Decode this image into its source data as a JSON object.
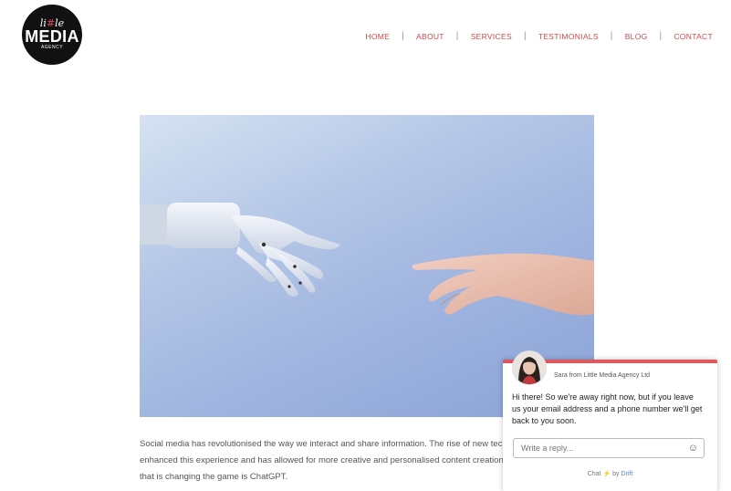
{
  "logo": {
    "line1_a": "li",
    "line1_hash": "#",
    "line1_b": "le",
    "line2": "MEDIA",
    "line3": "AGENCY"
  },
  "nav": {
    "items": [
      "HOME",
      "ABOUT",
      "SERVICES",
      "TESTIMONIALS",
      "BLOG",
      "CONTACT"
    ],
    "separator": "|"
  },
  "article": {
    "line1": "Social media has revolutionised the way we interact and share information. The rise of new tec",
    "line2": "enhanced this experience and has allowed for more creative and personalised content creation",
    "line3": "that is changing the game is ChatGPT."
  },
  "chat": {
    "sender": "Sara from Little Media Agency Ltd",
    "message": "Hi there! So we're away right now, but if you leave us your email address and a phone number we'll get back to you soon.",
    "reply_placeholder": "Write a reply...",
    "footer_chat": "Chat",
    "footer_by": "by",
    "footer_brand": "Drift",
    "accent_color": "#dc5a5e"
  },
  "colors": {
    "nav_link": "#d1484f",
    "hero_bg": "#a9bde3"
  }
}
